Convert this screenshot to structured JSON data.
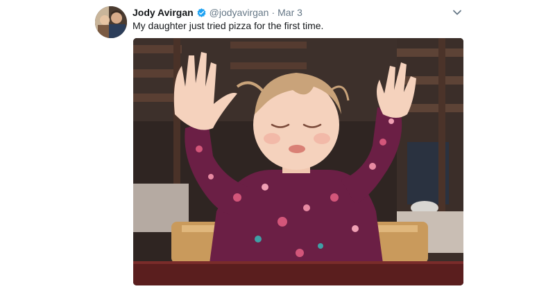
{
  "tweet": {
    "display_name": "Jody Avirgan",
    "verified": true,
    "handle": "@jodyavirgan",
    "separator": "·",
    "date": "Mar 3",
    "text": "My daughter just tried pizza for the first time.",
    "menu_icon": "chevron-down-icon",
    "media_icon": "photo"
  },
  "colors": {
    "name": "#14171a",
    "meta": "#657786",
    "verified": "#1da1f2",
    "dress": "#6b1f45"
  }
}
